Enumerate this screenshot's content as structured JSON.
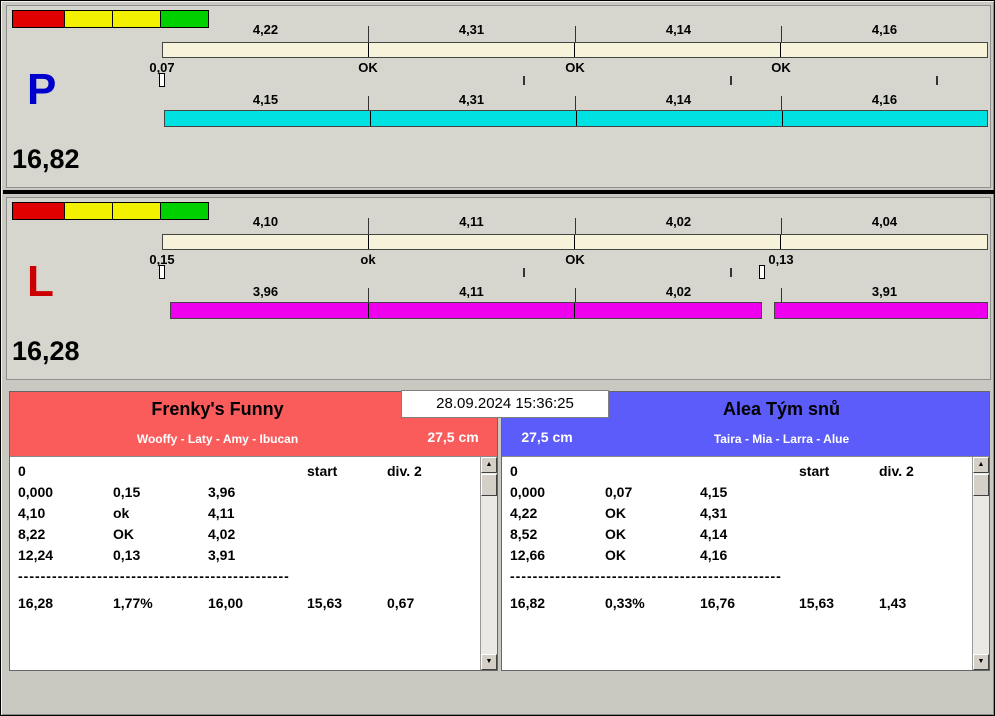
{
  "colors": {
    "upper_bar": "#f7f3da",
    "p_lower_bar": "#00e2e2",
    "l_lower_bar": "#ee00ee",
    "left_team_accent": "#fa5c5c",
    "right_team_accent": "#5c5cfa",
    "traffic": [
      "#e00000",
      "#f2f200",
      "#f2f200",
      "#00d000"
    ],
    "p_letter": "#0000cc",
    "l_letter": "#cc0000"
  },
  "lanes": {
    "p": {
      "letter": "P",
      "total": "16,82",
      "splits_top": [
        "4,22",
        "4,31",
        "4,14",
        "4,16"
      ],
      "marks": [
        "0,07",
        "OK",
        "OK",
        "OK"
      ],
      "splits_bottom": [
        "4,15",
        "4,31",
        "4,14",
        "4,16"
      ]
    },
    "l": {
      "letter": "L",
      "total": "16,28",
      "splits_top": [
        "4,10",
        "4,11",
        "4,02",
        "4,04"
      ],
      "marks": [
        "0,15",
        "ok",
        "OK",
        "0,13"
      ],
      "splits_bottom": [
        "3,96",
        "4,11",
        "4,02",
        "3,91"
      ]
    }
  },
  "scoreboard": {
    "timestamp": "28.09.2024 15:36:25",
    "left": {
      "team": "Frenky's Funny",
      "dogs": "Wooffy - Laty - Amy - Ibucan",
      "height": "27,5 cm",
      "table": {
        "zero": "0",
        "start_label": "start",
        "div_label": "div. 2",
        "rows": [
          [
            "0,000",
            "0,15",
            "3,96"
          ],
          [
            "4,10",
            "ok",
            "4,11"
          ],
          [
            "8,22",
            "OK",
            "4,02"
          ],
          [
            "12,24",
            "0,13",
            "3,91"
          ]
        ],
        "dashes": "------------------------------------------------",
        "totals": [
          "16,28",
          "1,77%",
          "16,00",
          "15,63",
          "0,67"
        ]
      }
    },
    "right": {
      "team": "Alea Tým snů",
      "dogs": "Taira - Mia - Larra - Alue",
      "height": "27,5 cm",
      "table": {
        "zero": "0",
        "start_label": "start",
        "div_label": "div. 2",
        "rows": [
          [
            "0,000",
            "0,07",
            "4,15"
          ],
          [
            "4,22",
            "OK",
            "4,31"
          ],
          [
            "8,52",
            "OK",
            "4,14"
          ],
          [
            "12,66",
            "OK",
            "4,16"
          ]
        ],
        "dashes": "------------------------------------------------",
        "totals": [
          "16,82",
          "0,33%",
          "16,76",
          "15,63",
          "1,43"
        ]
      }
    }
  },
  "icons": {
    "scroll_up": "▲",
    "scroll_down": "▼"
  }
}
